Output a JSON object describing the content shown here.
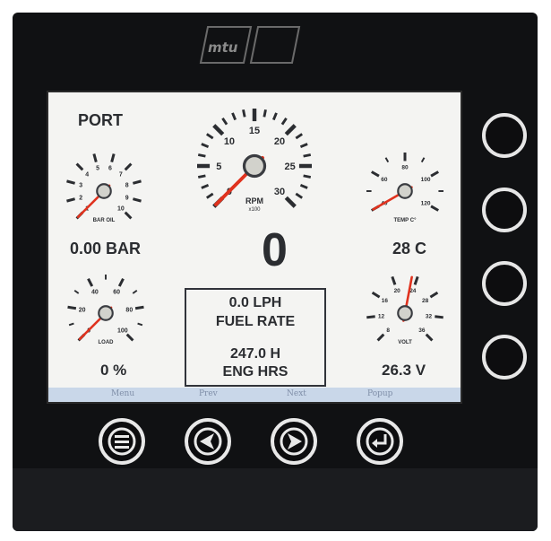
{
  "display": {
    "side_label": "PORT",
    "rpm_value": "0",
    "oil_pressure": {
      "label": "BAR  OIL",
      "readout": "0.00 BAR",
      "ticks": [
        "1",
        "2",
        "3",
        "4",
        "5",
        "6",
        "7",
        "8",
        "9",
        "10"
      ]
    },
    "rpm_gauge": {
      "label": "RPM",
      "multiplier": "x100",
      "ticks": [
        "0",
        "5",
        "10",
        "15",
        "20",
        "25",
        "30"
      ]
    },
    "coolant_temp": {
      "label": "TEMP  C°",
      "readout": "28 C",
      "ticks": [
        "40",
        "60",
        "80",
        "100",
        "120"
      ]
    },
    "load": {
      "label": "LOAD",
      "readout": "0 %",
      "ticks": [
        "0",
        "20",
        "40",
        "60",
        "80",
        "100"
      ]
    },
    "voltage": {
      "label": "VOLT",
      "readout": "26.3 V",
      "ticks": [
        "8",
        "12",
        "16",
        "20",
        "24",
        "28",
        "32",
        "36"
      ]
    },
    "info_box": {
      "fuel_rate": "0.0 LPH",
      "fuel_label": "FUEL RATE",
      "eng_hours": "247.0 H",
      "eng_hours_label": "ENG HRS"
    }
  },
  "softkeys": [
    "Menu",
    "Prev",
    "Next",
    "Popup"
  ],
  "brand": "mtu",
  "hardware_buttons": {
    "bottom": [
      "menu-icon",
      "left-arrow-icon",
      "right-arrow-icon",
      "enter-icon"
    ],
    "side_count": 4
  },
  "colors": {
    "needle": "#e0321e",
    "screen_bg": "#f4f4f2",
    "softbar": "#c9d7e9",
    "bezel": "#101113"
  }
}
